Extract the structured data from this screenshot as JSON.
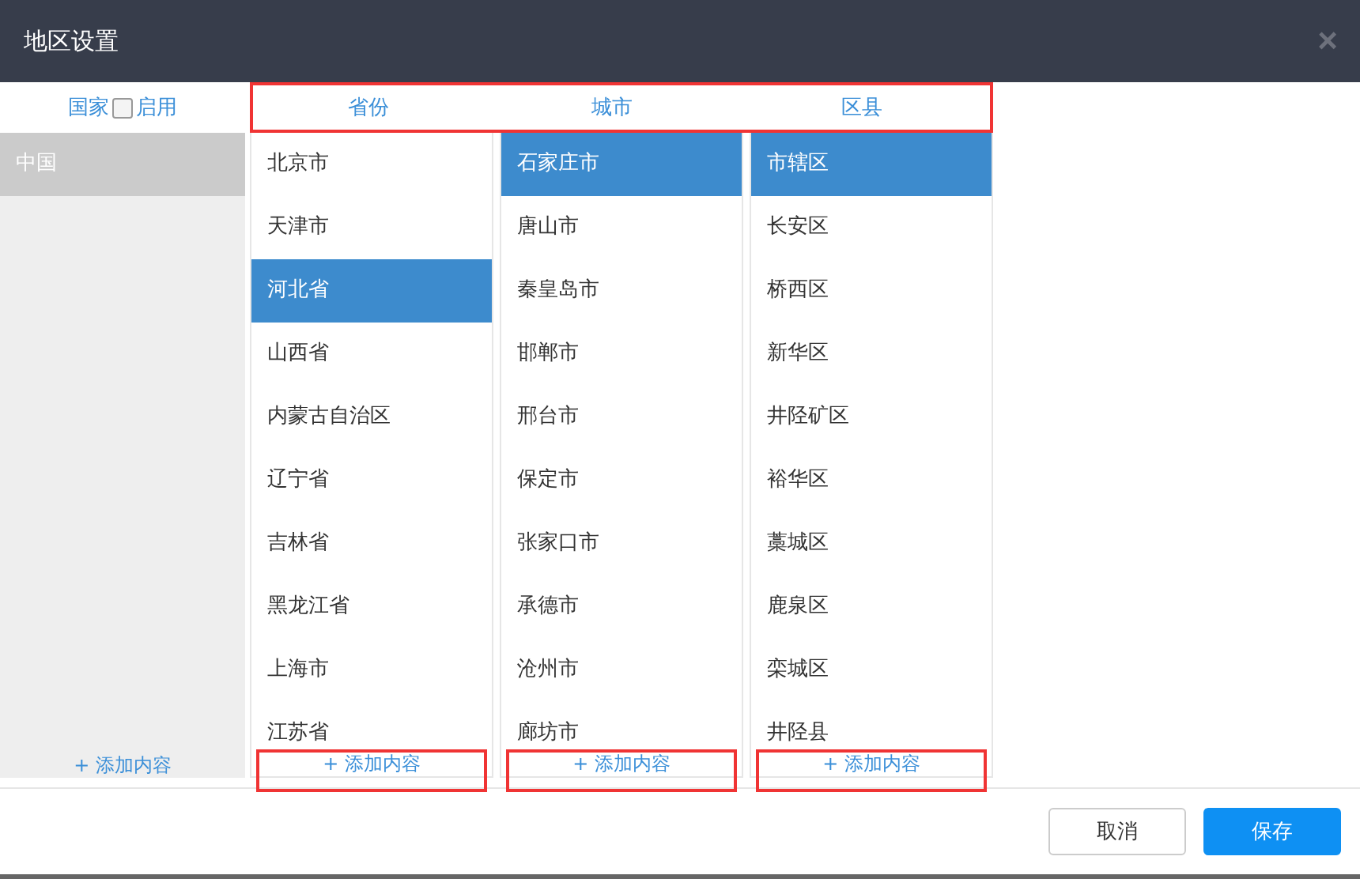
{
  "window": {
    "title": "地区设置",
    "close": "×"
  },
  "country": {
    "header": "国家",
    "enable_label": "启用",
    "enabled": false,
    "items": [
      {
        "label": "中国",
        "selected": true
      }
    ],
    "add_label": "+ 添加内容",
    "add_highlighted": false
  },
  "headers_highlighted": true,
  "columns": [
    {
      "header": "省份",
      "add_label": "+ 添加内容",
      "add_highlighted": true,
      "items": [
        {
          "label": "北京市",
          "selected": false
        },
        {
          "label": "天津市",
          "selected": false
        },
        {
          "label": "河北省",
          "selected": true
        },
        {
          "label": "山西省",
          "selected": false
        },
        {
          "label": "内蒙古自治区",
          "selected": false
        },
        {
          "label": "辽宁省",
          "selected": false
        },
        {
          "label": "吉林省",
          "selected": false
        },
        {
          "label": "黑龙江省",
          "selected": false
        },
        {
          "label": "上海市",
          "selected": false
        },
        {
          "label": "江苏省",
          "selected": false
        }
      ]
    },
    {
      "header": "城市",
      "add_label": "+ 添加内容",
      "add_highlighted": true,
      "items": [
        {
          "label": "石家庄市",
          "selected": true
        },
        {
          "label": "唐山市",
          "selected": false
        },
        {
          "label": "秦皇岛市",
          "selected": false
        },
        {
          "label": "邯郸市",
          "selected": false
        },
        {
          "label": "邢台市",
          "selected": false
        },
        {
          "label": "保定市",
          "selected": false
        },
        {
          "label": "张家口市",
          "selected": false
        },
        {
          "label": "承德市",
          "selected": false
        },
        {
          "label": "沧州市",
          "selected": false
        },
        {
          "label": "廊坊市",
          "selected": false
        }
      ]
    },
    {
      "header": "区县",
      "add_label": "+ 添加内容",
      "add_highlighted": true,
      "items": [
        {
          "label": "市辖区",
          "selected": true
        },
        {
          "label": "长安区",
          "selected": false
        },
        {
          "label": "桥西区",
          "selected": false
        },
        {
          "label": "新华区",
          "selected": false
        },
        {
          "label": "井陉矿区",
          "selected": false
        },
        {
          "label": "裕华区",
          "selected": false
        },
        {
          "label": "藁城区",
          "selected": false
        },
        {
          "label": "鹿泉区",
          "selected": false
        },
        {
          "label": "栾城区",
          "selected": false
        },
        {
          "label": "井陉县",
          "selected": false
        }
      ]
    }
  ],
  "buttons": [
    {
      "label": "取消",
      "kind": "secondary"
    },
    {
      "label": "保存",
      "kind": "primary"
    }
  ]
}
